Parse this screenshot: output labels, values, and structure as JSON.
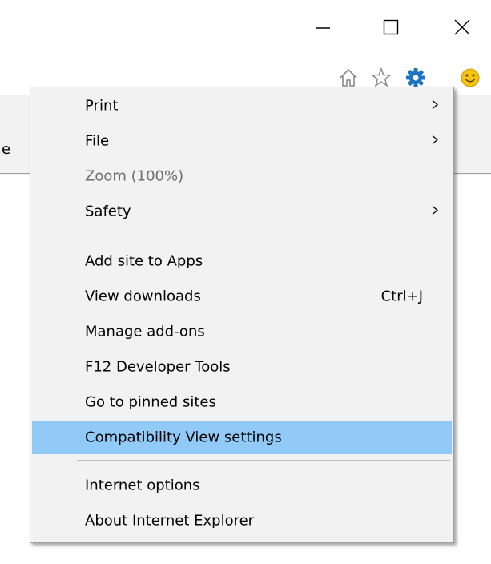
{
  "background": {
    "partial_text": "e"
  },
  "menu": {
    "items": [
      {
        "label": "Print",
        "shortcut": "",
        "submenu": true,
        "disabled": false,
        "highlighted": false
      },
      {
        "label": "File",
        "shortcut": "",
        "submenu": true,
        "disabled": false,
        "highlighted": false
      },
      {
        "label": "Zoom (100%)",
        "shortcut": "",
        "submenu": false,
        "disabled": true,
        "highlighted": false
      },
      {
        "label": "Safety",
        "shortcut": "",
        "submenu": true,
        "disabled": false,
        "highlighted": false
      },
      {
        "label": "Add site to Apps",
        "shortcut": "",
        "submenu": false,
        "disabled": false,
        "highlighted": false
      },
      {
        "label": "View downloads",
        "shortcut": "Ctrl+J",
        "submenu": false,
        "disabled": false,
        "highlighted": false
      },
      {
        "label": "Manage add-ons",
        "shortcut": "",
        "submenu": false,
        "disabled": false,
        "highlighted": false
      },
      {
        "label": "F12 Developer Tools",
        "shortcut": "",
        "submenu": false,
        "disabled": false,
        "highlighted": false
      },
      {
        "label": "Go to pinned sites",
        "shortcut": "",
        "submenu": false,
        "disabled": false,
        "highlighted": false
      },
      {
        "label": "Compatibility View settings",
        "shortcut": "",
        "submenu": false,
        "disabled": false,
        "highlighted": true
      },
      {
        "label": "Internet options",
        "shortcut": "",
        "submenu": false,
        "disabled": false,
        "highlighted": false
      },
      {
        "label": "About Internet Explorer",
        "shortcut": "",
        "submenu": false,
        "disabled": false,
        "highlighted": false
      }
    ]
  },
  "colors": {
    "highlight": "#91c9f7",
    "menu_background": "#f2f2f2",
    "disabled_text": "#6d6d6d",
    "gear_icon": "#1c73c4",
    "smiley_icon": "#f5c211"
  },
  "icons": {
    "caption": [
      "minimize-icon",
      "maximize-icon",
      "close-icon"
    ],
    "toolbar": [
      "home-icon",
      "favorites-star-icon",
      "tools-gear-icon",
      "feedback-smiley-icon"
    ]
  }
}
